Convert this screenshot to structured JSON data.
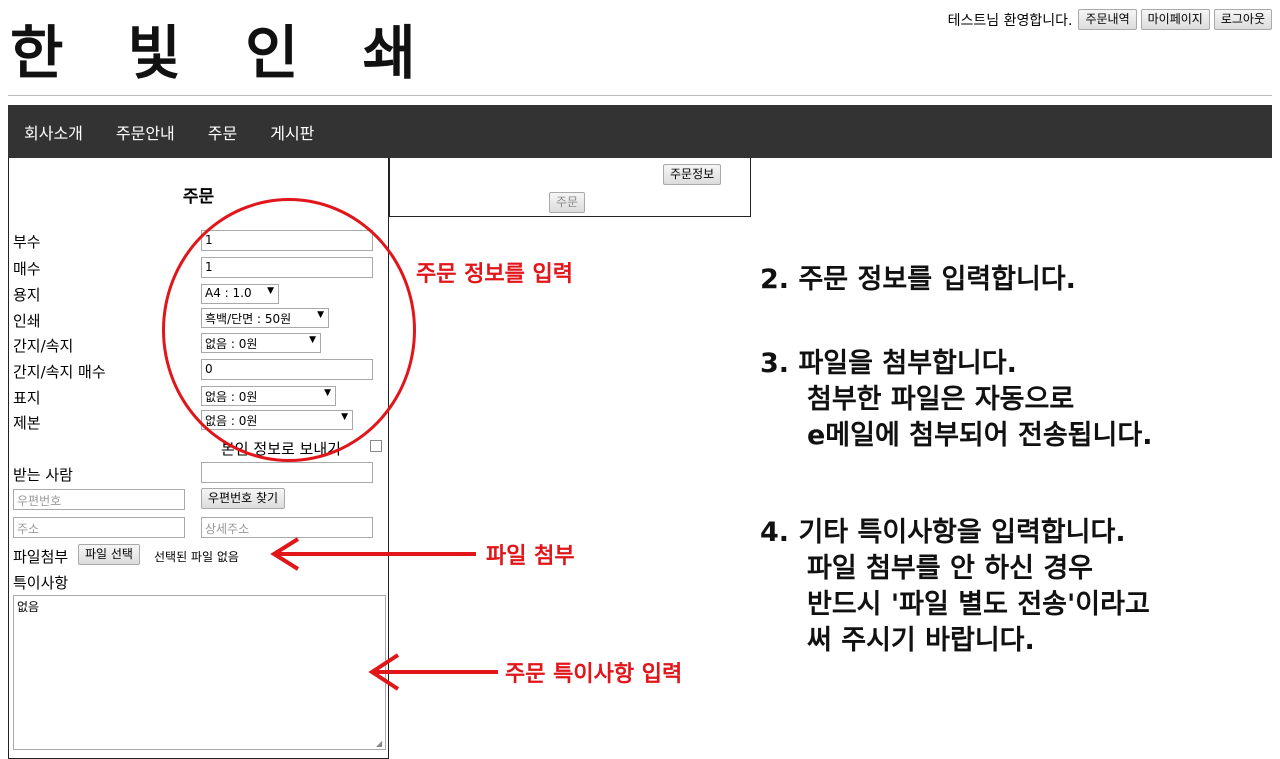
{
  "logo": "한 빛 인 쇄",
  "header": {
    "welcome": "테스트님 환영합니다.",
    "buttons": [
      "주문내역",
      "마이페이지",
      "로그아웃"
    ]
  },
  "nav": [
    "회사소개",
    "주문안내",
    "주문",
    "게시판"
  ],
  "form": {
    "title": "주문",
    "fields": {
      "copies_label": "부수",
      "copies_value": "1",
      "sheets_label": "매수",
      "sheets_value": "1",
      "paper_label": "용지",
      "paper_value": "A4 : 1.0",
      "print_label": "인쇄",
      "print_value": "흑백/단면 : 50원",
      "insert_label": "간지/속지",
      "insert_value": "없음 : 0원",
      "insert_count_label": "간지/속지 매수",
      "insert_count_value": "0",
      "cover_label": "표지",
      "cover_value": "없음 : 0원",
      "binding_label": "제본",
      "binding_value": "없음 : 0원",
      "send_self_label": "본인 정보로 보내기",
      "recipient_label": "받는 사람",
      "postcode_placeholder": "우편번호",
      "postcode_button": "우편번호 찾기",
      "address_placeholder": "주소",
      "address_detail_placeholder": "상세주소",
      "file_label": "파일첨부",
      "file_button": "파일 선택",
      "file_status": "선택된 파일 없음",
      "notes_label": "특이사항",
      "notes_value": "없음"
    }
  },
  "info_panel": {
    "info_button": "주문정보",
    "order_button": "주문"
  },
  "annotations": {
    "order_info": "주문 정보를 입력",
    "file_attach": "파일 첨부",
    "notes": "주문 특이사항 입력"
  },
  "instructions": {
    "step2": "2. 주문 정보를 입력합니다.",
    "step3_line1": "3. 파일을 첨부합니다.",
    "step3_line2": "첨부한 파일은 자동으로",
    "step3_line3": "e메일에 첨부되어 전송됩니다.",
    "step4_line1": "4. 기타 특이사항을 입력합니다.",
    "step4_line2": "파일 첨부를 안 하신 경우",
    "step4_line3": "반드시 '파일 별도 전송'이라고",
    "step4_line4": "써 주시기 바랍니다."
  },
  "colors": {
    "nav_bg": "#333333",
    "annotation_red": "#e0161b"
  }
}
